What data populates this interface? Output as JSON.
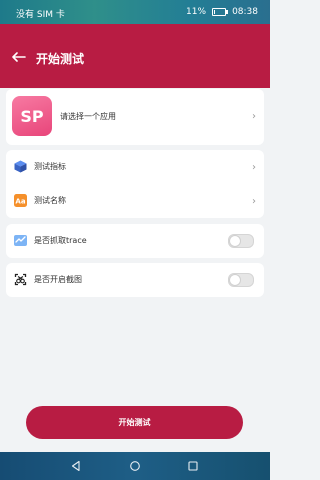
{
  "status_bar": {
    "carrier": "没有 SIM 卡",
    "battery": "11%",
    "battery_level": 0.11,
    "time": "08:38"
  },
  "header": {
    "title": "开始测试"
  },
  "app_selector": {
    "icon_text": "SP",
    "label": "请选择一个应用"
  },
  "test_options": {
    "metrics_label": "测试指标",
    "name_label": "测试名称"
  },
  "capture_trace": {
    "label": "是否抓取trace",
    "enabled": false
  },
  "screenshot": {
    "label": "是否开启截图",
    "enabled": false
  },
  "start_button": {
    "label": "开始测试"
  },
  "colors": {
    "accent": "#b81c43"
  }
}
